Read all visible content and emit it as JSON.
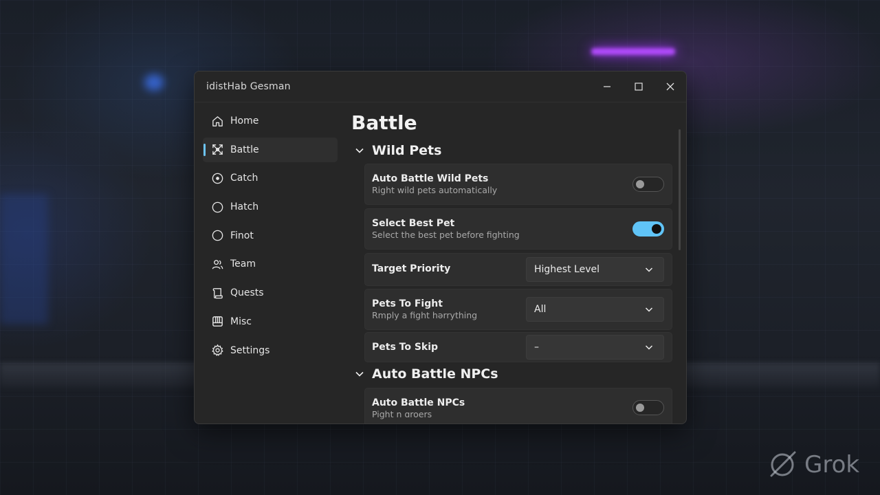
{
  "window": {
    "title": "idistHab Gesman",
    "controls": [
      "minimize",
      "maximize",
      "close"
    ]
  },
  "sidebar": {
    "items": [
      {
        "label": "Home",
        "icon": "home-icon",
        "active": false
      },
      {
        "label": "Battle",
        "icon": "battle-icon",
        "active": true
      },
      {
        "label": "Catch",
        "icon": "target-icon",
        "active": false
      },
      {
        "label": "Hatch",
        "icon": "circle-icon",
        "active": false
      },
      {
        "label": "Finot",
        "icon": "circle-icon",
        "active": false
      },
      {
        "label": "Team",
        "icon": "users-icon",
        "active": false
      },
      {
        "label": "Quests",
        "icon": "scroll-icon",
        "active": false
      },
      {
        "label": "Misc",
        "icon": "box-icon",
        "active": false
      },
      {
        "label": "Settings",
        "icon": "gear-icon",
        "active": false
      }
    ]
  },
  "main": {
    "title": "Battle",
    "sections": [
      {
        "title": "Wild Pets",
        "settings": [
          {
            "label": "Auto Battle Wild Pets",
            "sub": "Right wild pets automatically",
            "type": "toggle",
            "value": false
          },
          {
            "label": "Select Best Pet",
            "sub": "Select the best pet before fighting",
            "type": "toggle",
            "value": true
          },
          {
            "label": "Target Priority",
            "type": "dropdown",
            "value": "Highest Level"
          },
          {
            "label": "Pets To Fight",
            "sub": "Rmply a fight hərrything",
            "type": "dropdown",
            "value": "All"
          },
          {
            "label": "Pets To Skip",
            "type": "dropdown",
            "value": "–"
          }
        ]
      },
      {
        "title": "Auto Battle NPCs",
        "settings": [
          {
            "label": "Auto Battle NPCs",
            "sub": "Pight n ɑroers",
            "type": "toggle",
            "value": false
          }
        ]
      }
    ]
  },
  "watermark": {
    "text": "Grok"
  },
  "colors": {
    "accent": "#60c4f7",
    "window_bg": "#262626",
    "card_bg": "#2e2e2e"
  }
}
